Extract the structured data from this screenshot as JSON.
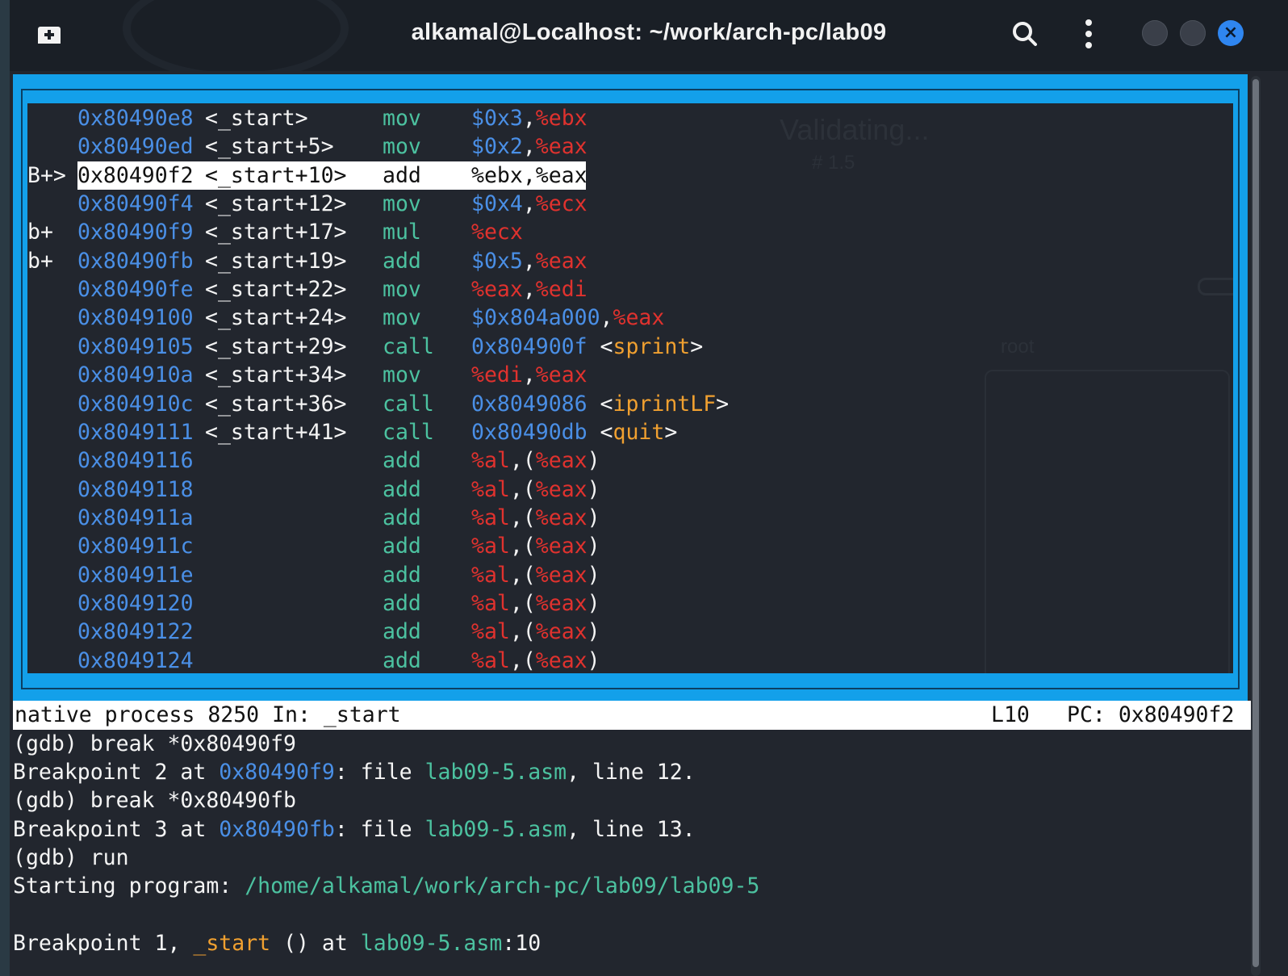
{
  "window": {
    "title": "alkamal@Localhost: ~/work/arch-pc/lab09",
    "buttons": {
      "close_glyph": "×"
    },
    "colors": {
      "accent": "#13a0ea",
      "close": "#2f86f0"
    }
  },
  "icons": [
    "new-tab-icon",
    "search-icon",
    "kebab-menu-icon",
    "minimize-icon",
    "maximize-icon",
    "close-icon"
  ],
  "watermark": {
    "validating": "Validating...",
    "sub": "# 1.5",
    "user": "root"
  },
  "source_panel": {
    "rows": [
      {
        "mark": "",
        "addr": "0x80490e8",
        "sym": "<_start>",
        "op": "mov",
        "args": [
          {
            "t": "$0x3",
            "c": "num"
          },
          {
            "t": ",",
            "c": "w"
          },
          {
            "t": "%ebx",
            "c": "reg"
          }
        ]
      },
      {
        "mark": "",
        "addr": "0x80490ed",
        "sym": "<_start+5>",
        "op": "mov",
        "args": [
          {
            "t": "$0x2",
            "c": "num"
          },
          {
            "t": ",",
            "c": "w"
          },
          {
            "t": "%eax",
            "c": "reg"
          }
        ]
      },
      {
        "mark": "B+>",
        "addr": "0x80490f2",
        "sym": "<_start+10>",
        "op": "add",
        "highlight": true,
        "args": [
          {
            "t": "%ebx,%eax",
            "c": "w"
          }
        ]
      },
      {
        "mark": "",
        "addr": "0x80490f4",
        "sym": "<_start+12>",
        "op": "mov",
        "args": [
          {
            "t": "$0x4",
            "c": "num"
          },
          {
            "t": ",",
            "c": "w"
          },
          {
            "t": "%ecx",
            "c": "reg"
          }
        ]
      },
      {
        "mark": "b+",
        "addr": "0x80490f9",
        "sym": "<_start+17>",
        "op": "mul",
        "args": [
          {
            "t": "%ecx",
            "c": "reg"
          }
        ]
      },
      {
        "mark": "b+",
        "addr": "0x80490fb",
        "sym": "<_start+19>",
        "op": "add",
        "args": [
          {
            "t": "$0x5",
            "c": "num"
          },
          {
            "t": ",",
            "c": "w"
          },
          {
            "t": "%eax",
            "c": "reg"
          }
        ]
      },
      {
        "mark": "",
        "addr": "0x80490fe",
        "sym": "<_start+22>",
        "op": "mov",
        "args": [
          {
            "t": "%eax",
            "c": "reg"
          },
          {
            "t": ",",
            "c": "w"
          },
          {
            "t": "%edi",
            "c": "reg"
          }
        ]
      },
      {
        "mark": "",
        "addr": "0x8049100",
        "sym": "<_start+24>",
        "op": "mov",
        "args": [
          {
            "t": "$0x804a000",
            "c": "num"
          },
          {
            "t": ",",
            "c": "w"
          },
          {
            "t": "%eax",
            "c": "reg"
          }
        ]
      },
      {
        "mark": "",
        "addr": "0x8049105",
        "sym": "<_start+29>",
        "op": "call",
        "args": [
          {
            "t": "0x804900f",
            "c": "num"
          },
          {
            "t": " <",
            "c": "w"
          },
          {
            "t": "sprint",
            "c": "fn"
          },
          {
            "t": ">",
            "c": "w"
          }
        ]
      },
      {
        "mark": "",
        "addr": "0x804910a",
        "sym": "<_start+34>",
        "op": "mov",
        "args": [
          {
            "t": "%edi",
            "c": "reg"
          },
          {
            "t": ",",
            "c": "w"
          },
          {
            "t": "%eax",
            "c": "reg"
          }
        ]
      },
      {
        "mark": "",
        "addr": "0x804910c",
        "sym": "<_start+36>",
        "op": "call",
        "args": [
          {
            "t": "0x8049086",
            "c": "num"
          },
          {
            "t": " <",
            "c": "w"
          },
          {
            "t": "iprintLF",
            "c": "fn"
          },
          {
            "t": ">",
            "c": "w"
          }
        ]
      },
      {
        "mark": "",
        "addr": "0x8049111",
        "sym": "<_start+41>",
        "op": "call",
        "args": [
          {
            "t": "0x80490db",
            "c": "num"
          },
          {
            "t": " <",
            "c": "w"
          },
          {
            "t": "quit",
            "c": "fn"
          },
          {
            "t": ">",
            "c": "w"
          }
        ]
      },
      {
        "mark": "",
        "addr": "0x8049116",
        "sym": "",
        "op": "add",
        "args": [
          {
            "t": "%al",
            "c": "reg"
          },
          {
            "t": ",(",
            "c": "w"
          },
          {
            "t": "%eax",
            "c": "reg"
          },
          {
            "t": ")",
            "c": "w"
          }
        ]
      },
      {
        "mark": "",
        "addr": "0x8049118",
        "sym": "",
        "op": "add",
        "args": [
          {
            "t": "%al",
            "c": "reg"
          },
          {
            "t": ",(",
            "c": "w"
          },
          {
            "t": "%eax",
            "c": "reg"
          },
          {
            "t": ")",
            "c": "w"
          }
        ]
      },
      {
        "mark": "",
        "addr": "0x804911a",
        "sym": "",
        "op": "add",
        "args": [
          {
            "t": "%al",
            "c": "reg"
          },
          {
            "t": ",(",
            "c": "w"
          },
          {
            "t": "%eax",
            "c": "reg"
          },
          {
            "t": ")",
            "c": "w"
          }
        ]
      },
      {
        "mark": "",
        "addr": "0x804911c",
        "sym": "",
        "op": "add",
        "args": [
          {
            "t": "%al",
            "c": "reg"
          },
          {
            "t": ",(",
            "c": "w"
          },
          {
            "t": "%eax",
            "c": "reg"
          },
          {
            "t": ")",
            "c": "w"
          }
        ]
      },
      {
        "mark": "",
        "addr": "0x804911e",
        "sym": "",
        "op": "add",
        "args": [
          {
            "t": "%al",
            "c": "reg"
          },
          {
            "t": ",(",
            "c": "w"
          },
          {
            "t": "%eax",
            "c": "reg"
          },
          {
            "t": ")",
            "c": "w"
          }
        ]
      },
      {
        "mark": "",
        "addr": "0x8049120",
        "sym": "",
        "op": "add",
        "args": [
          {
            "t": "%al",
            "c": "reg"
          },
          {
            "t": ",(",
            "c": "w"
          },
          {
            "t": "%eax",
            "c": "reg"
          },
          {
            "t": ")",
            "c": "w"
          }
        ]
      },
      {
        "mark": "",
        "addr": "0x8049122",
        "sym": "",
        "op": "add",
        "args": [
          {
            "t": "%al",
            "c": "reg"
          },
          {
            "t": ",(",
            "c": "w"
          },
          {
            "t": "%eax",
            "c": "reg"
          },
          {
            "t": ")",
            "c": "w"
          }
        ]
      },
      {
        "mark": "",
        "addr": "0x8049124",
        "sym": "",
        "op": "add",
        "args": [
          {
            "t": "%al",
            "c": "reg"
          },
          {
            "t": ",(",
            "c": "w"
          },
          {
            "t": "%eax",
            "c": "reg"
          },
          {
            "t": ")",
            "c": "w"
          }
        ]
      }
    ]
  },
  "status_bar": {
    "process": "native process 8250 In: _start",
    "line": "L10",
    "pc": "PC: 0x80490f2"
  },
  "console": [
    [
      {
        "t": "(gdb) break *0x80490f9",
        "c": "w"
      }
    ],
    [
      {
        "t": "Breakpoint 2 at ",
        "c": "w"
      },
      {
        "t": "0x80490f9",
        "c": "blue"
      },
      {
        "t": ": file ",
        "c": "w"
      },
      {
        "t": "lab09-5.asm",
        "c": "teal"
      },
      {
        "t": ", line 12.",
        "c": "w"
      }
    ],
    [
      {
        "t": "(gdb) break *0x80490fb",
        "c": "w"
      }
    ],
    [
      {
        "t": "Breakpoint 3 at ",
        "c": "w"
      },
      {
        "t": "0x80490fb",
        "c": "blue"
      },
      {
        "t": ": file ",
        "c": "w"
      },
      {
        "t": "lab09-5.asm",
        "c": "teal"
      },
      {
        "t": ", line 13.",
        "c": "w"
      }
    ],
    [
      {
        "t": "(gdb) run",
        "c": "w"
      }
    ],
    [
      {
        "t": "Starting program: ",
        "c": "w"
      },
      {
        "t": "/home/alkamal/work/arch-pc/lab09/lab09-5",
        "c": "teal"
      }
    ],
    [],
    [
      {
        "t": "Breakpoint 1, ",
        "c": "w"
      },
      {
        "t": "_start",
        "c": "orange"
      },
      {
        "t": " () at ",
        "c": "w"
      },
      {
        "t": "lab09-5.asm",
        "c": "teal"
      },
      {
        "t": ":10",
        "c": "w"
      }
    ]
  ]
}
